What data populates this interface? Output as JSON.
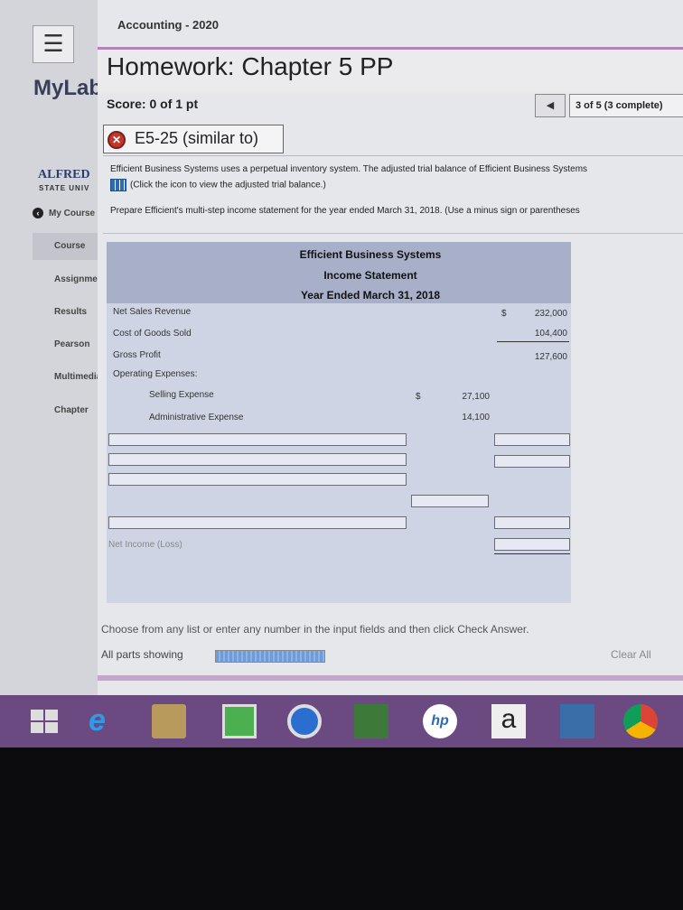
{
  "header": {
    "course": "Accounting - 2020",
    "app": "MyLab",
    "homework_title": "Homework: Chapter 5 PP",
    "score": "Score: 0 of 1 pt",
    "pager_prev": "◀",
    "pager_text": "3 of 5 (3 complete)"
  },
  "sidebar": {
    "logo_name": "ALFRED",
    "logo_sub": "STATE UNIV",
    "my_course": "My Course",
    "items": [
      "Course",
      "Assignments",
      "Results",
      "Pearson",
      "Multimedia",
      "Chapter"
    ]
  },
  "question": {
    "label": "E5-25 (similar to)",
    "status_icon": "x-circle-icon",
    "text1": "Efficient Business Systems uses a perpetual inventory system. The adjusted trial balance of Efficient Business Systems",
    "text2": "(Click the icon to view the adjusted trial balance.)",
    "text3": "Prepare Efficient's multi-step income statement for the year ended March 31, 2018. (Use a minus sign or parentheses"
  },
  "statement": {
    "company": "Efficient Business Systems",
    "title": "Income Statement",
    "period": "Year Ended March 31, 2018",
    "currency_symbol": "$",
    "lines": {
      "net_sales_label": "Net Sales Revenue",
      "net_sales_value": "232,000",
      "cogs_label": "Cost of Goods Sold",
      "cogs_value": "104,400",
      "gross_profit_label": "Gross Profit",
      "gross_profit_value": "127,600",
      "opex_label": "Operating Expenses:",
      "selling_label": "Selling Expense",
      "selling_value": "27,100",
      "admin_label": "Administrative Expense",
      "admin_value": "14,100"
    },
    "net_income_placeholder": "Net Income (Loss)"
  },
  "footer": {
    "instruction": "Choose from any list or enter any number in the input fields and then click Check Answer.",
    "parts_showing": "All parts showing",
    "progress_fraction": 1.0,
    "clear_all": "Clear All"
  },
  "taskbar": {
    "icons": [
      "windows-start-icon",
      "internet-explorer-icon",
      "file-explorer-icon",
      "store-icon",
      "media-player-icon",
      "games-icon",
      "hp-icon",
      "amazon-icon",
      "photos-icon",
      "chrome-icon"
    ],
    "amazon_letter": "a",
    "hp_text": "hp"
  }
}
